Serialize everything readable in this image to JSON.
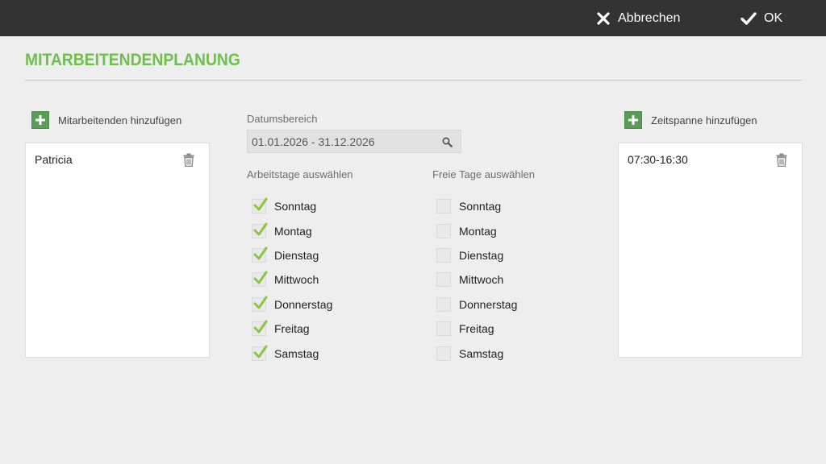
{
  "toolbar": {
    "cancel_label": "Abbrechen",
    "ok_label": "OK"
  },
  "page": {
    "title": "MITARBEITENDENPLANUNG"
  },
  "employees": {
    "add_label": "Mitarbeitenden hinzufügen",
    "items": [
      {
        "name": "Patricia"
      }
    ]
  },
  "date_range": {
    "label": "Datumsbereich",
    "value": "01.01.2026 - 31.12.2026"
  },
  "workdays": {
    "label": "Arbeitstage auswählen",
    "items": [
      {
        "label": "Sonntag",
        "checked": true
      },
      {
        "label": "Montag",
        "checked": true
      },
      {
        "label": "Dienstag",
        "checked": true
      },
      {
        "label": "Mittwoch",
        "checked": true
      },
      {
        "label": "Donnerstag",
        "checked": true
      },
      {
        "label": "Freitag",
        "checked": true
      },
      {
        "label": "Samstag",
        "checked": true
      }
    ]
  },
  "freedays": {
    "label": "Freie Tage auswählen",
    "items": [
      {
        "label": "Sonntag",
        "checked": false
      },
      {
        "label": "Montag",
        "checked": false
      },
      {
        "label": "Dienstag",
        "checked": false
      },
      {
        "label": "Mittwoch",
        "checked": false
      },
      {
        "label": "Donnerstag",
        "checked": false
      },
      {
        "label": "Freitag",
        "checked": false
      },
      {
        "label": "Samstag",
        "checked": false
      }
    ]
  },
  "timespans": {
    "add_label": "Zeitspanne hinzufügen",
    "items": [
      {
        "range": "07:30-16:30"
      }
    ]
  },
  "colors": {
    "accent": "#6fbf4f",
    "topbar": "#333333",
    "add_button": "#5a9b58",
    "check": "#8cc63f"
  },
  "icons": {
    "cancel": "close-icon",
    "ok": "checkmark-icon",
    "add": "plus-icon",
    "delete": "trash-icon",
    "search": "search-icon"
  }
}
